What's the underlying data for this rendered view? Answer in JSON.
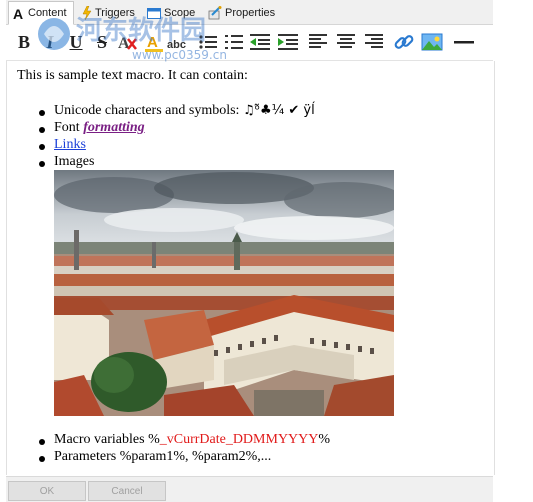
{
  "tabs": [
    {
      "label": "Content",
      "icon": "font-A-icon",
      "active": true
    },
    {
      "label": "Triggers",
      "icon": "lightning-icon",
      "active": false
    },
    {
      "label": "Scope",
      "icon": "scope-icon",
      "active": false
    },
    {
      "label": "Properties",
      "icon": "properties-icon",
      "active": false
    }
  ],
  "toolbar": {
    "bold_label": "B",
    "italic_label": "I",
    "underline_label": "U",
    "strike_label": "S",
    "font_label": "A",
    "abc_label": "abc",
    "icons": [
      "bold-icon",
      "italic-icon",
      "underline-icon",
      "strikethrough-icon",
      "remove-format-icon",
      "font-color-icon",
      "font-size-icon",
      "bullet-list-icon",
      "numbered-list-icon",
      "outdent-icon",
      "indent-icon",
      "align-left-icon",
      "align-center-icon",
      "align-right-icon",
      "link-icon",
      "image-icon",
      "horizontal-rule-icon"
    ]
  },
  "editor": {
    "intro": "This is sample text macro. It can contain:",
    "items": {
      "unicode_label": "Unicode characters and symbols: ",
      "unicode_symbols": "♫ᵒ̃♣¼ ✔ ÿĺ",
      "font_label": "Font ",
      "font_formatted": "formatting",
      "links": "Links",
      "images": "Images",
      "macro_prefix": "Macro variables %",
      "macro_var": "_vCurrDate_DDMMYYYY",
      "macro_suffix": "%",
      "params": "Parameters %param1%, %param2%,..."
    }
  },
  "footer": {
    "ok": "OK",
    "cancel": "Cancel"
  },
  "watermark": {
    "title": "河东软件园",
    "url": "www.pc0359.cn"
  },
  "colors": {
    "accent_link": "#1a3fd8",
    "format_purple": "#7a1f84",
    "macro_red": "#e11a1a"
  }
}
